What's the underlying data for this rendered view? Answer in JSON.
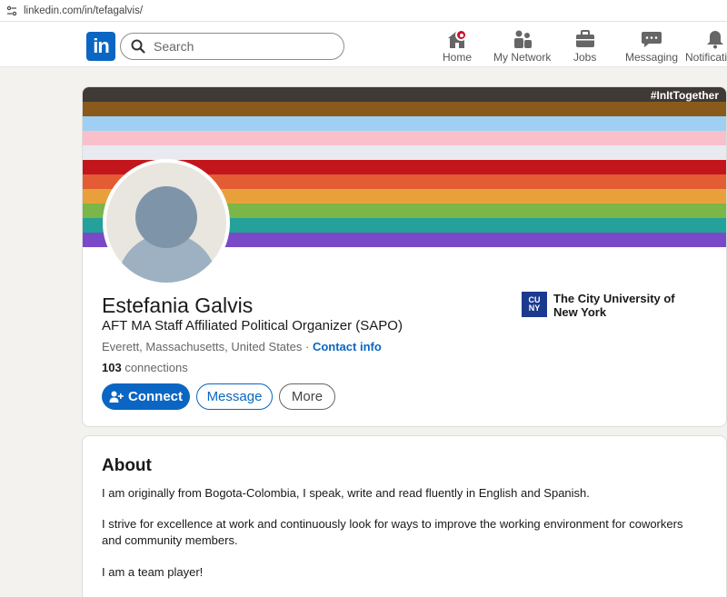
{
  "browser": {
    "url": "linkedin.com/in/tefagalvis/"
  },
  "nav": {
    "logo": "in",
    "search_placeholder": "Search",
    "items": [
      {
        "label": "Home",
        "icon": "home-icon"
      },
      {
        "label": "My Network",
        "icon": "network-icon"
      },
      {
        "label": "Jobs",
        "icon": "briefcase-icon"
      },
      {
        "label": "Messaging",
        "icon": "message-icon"
      },
      {
        "label": "Notifications",
        "icon": "bell-icon"
      }
    ]
  },
  "banner": {
    "hashtag": "#InItTogether",
    "stripe_colors": [
      "#3f3a36",
      "#8a5a1c",
      "#9fd0f3",
      "#f9c0cc",
      "#e9eaf0",
      "#c3161c",
      "#e45c34",
      "#e8a13a",
      "#7ab648",
      "#23a19a",
      "#7a49c7"
    ]
  },
  "profile": {
    "name": "Estefania Galvis",
    "headline": "AFT MA Staff Affiliated Political Organizer (SAPO)",
    "location": "Everett, Massachusetts, United States",
    "location_separator": " · ",
    "contact_info": "Contact info",
    "connections_count": "103",
    "connections_label": " connections",
    "education": {
      "logo_text": "CUNY",
      "name": "The City University of New York"
    }
  },
  "actions": {
    "connect": "Connect",
    "message": "Message",
    "more": "More"
  },
  "about": {
    "title": "About",
    "paragraphs": [
      "I am originally from Bogota-Colombia, I speak, write and read fluently in English and Spanish.",
      "I strive for excellence at work and continuously look for ways to improve the working environment for coworkers and community members.",
      "I am a team player!"
    ]
  },
  "colors": {
    "brand": "#0a66c2",
    "badge": "#cb112d",
    "page_bg": "#f4f2ee"
  }
}
